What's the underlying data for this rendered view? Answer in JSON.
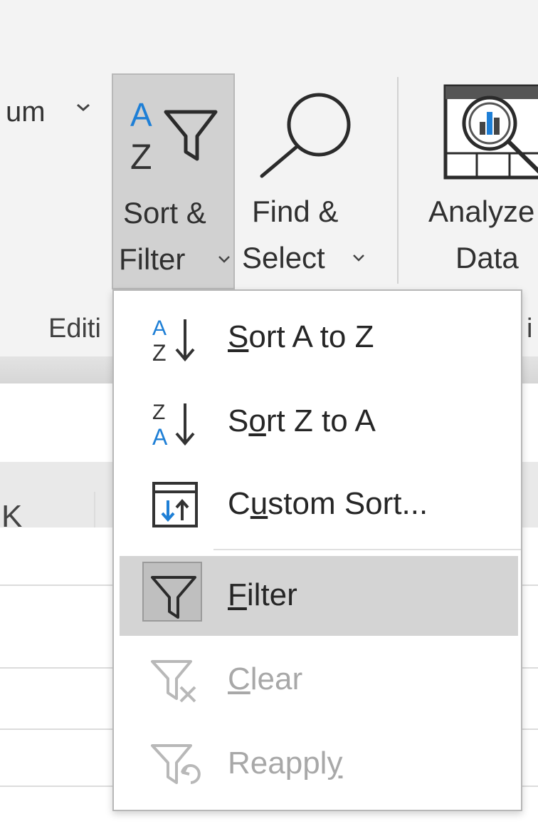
{
  "ribbon": {
    "left_partial_text": "um",
    "sort_filter": {
      "line1": "Sort &",
      "line2": "Filter"
    },
    "find_select": {
      "line1": "Find &",
      "line2": "Select"
    },
    "analyze": {
      "line1": "Analyze",
      "line2": "Data"
    },
    "group_editing_label": "Editi",
    "group_analysis_label": "i"
  },
  "grid": {
    "col_header_partial": "K"
  },
  "menu": {
    "items": [
      {
        "label": "Sort A to Z",
        "mnemonic_index": 0
      },
      {
        "label": "Sort Z to A",
        "mnemonic_index": 1
      },
      {
        "label": "Custom Sort...",
        "mnemonic_index": 1
      },
      {
        "label": "Filter",
        "mnemonic_index": 0
      },
      {
        "label": "Clear",
        "mnemonic_index": 0
      },
      {
        "label": "Reapply",
        "mnemonic_index": 6
      }
    ]
  },
  "colors": {
    "accent_blue": "#1e7fd6",
    "hover_gray": "#d4d4d4",
    "disabled_text": "#a8a8a8"
  }
}
